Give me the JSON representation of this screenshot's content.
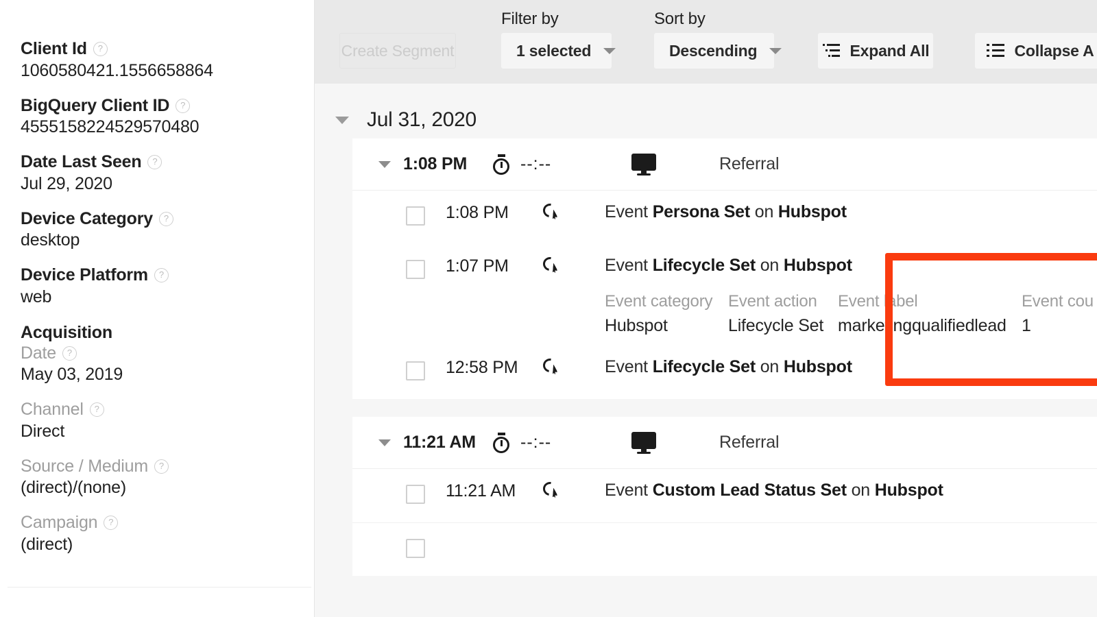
{
  "sidebar": {
    "fields": [
      {
        "label": "Client Id",
        "muted": false,
        "help": "?",
        "value": "1060580421.1556658864"
      },
      {
        "label": "BigQuery Client ID",
        "muted": false,
        "help": "?",
        "value": "4555158224529570480"
      },
      {
        "label": "Date Last Seen",
        "muted": false,
        "help": "?",
        "value": "Jul 29, 2020"
      },
      {
        "label": "Device Category",
        "muted": false,
        "help": "?",
        "value": "desktop"
      },
      {
        "label": "Device Platform",
        "muted": false,
        "help": "?",
        "value": "web"
      }
    ],
    "acquisition_heading": "Acquisition",
    "acquisition_fields": [
      {
        "label": "Date",
        "muted": true,
        "help": "?",
        "value": "May 03, 2019"
      },
      {
        "label": "Channel",
        "muted": true,
        "help": "?",
        "value": "Direct"
      },
      {
        "label": "Source / Medium",
        "muted": true,
        "help": "?",
        "value": "(direct)/(none)"
      },
      {
        "label": "Campaign",
        "muted": true,
        "help": "?",
        "value": "(direct)"
      }
    ]
  },
  "toolbar": {
    "create_segment_label": "Create Segment",
    "filter_caption": "Filter by",
    "filter_value": "1 selected",
    "sort_caption": "Sort by",
    "sort_value": "Descending",
    "expand_all_label": "Expand All",
    "collapse_all_label": "Collapse A"
  },
  "timeline": {
    "day_label": "Jul 31, 2020",
    "sessions": [
      {
        "time": "1:08 PM",
        "duration": "--:--",
        "channel": "Referral",
        "events": [
          {
            "time": "1:08 PM",
            "prefix": "Event ",
            "name": "Persona Set",
            "middle": " on ",
            "source": "Hubspot",
            "expanded": false
          },
          {
            "time": "1:07 PM",
            "prefix": "Event ",
            "name": "Lifecycle Set",
            "middle": " on ",
            "source": "Hubspot",
            "expanded": true,
            "params": [
              {
                "key": "Event category",
                "value": "Hubspot"
              },
              {
                "key": "Event action",
                "value": "Lifecycle Set"
              },
              {
                "key": "Event label",
                "value": "marketingqualifiedlead"
              },
              {
                "key": "Event cou",
                "value": "1"
              }
            ]
          },
          {
            "time": "12:58 PM",
            "prefix": "Event ",
            "name": "Lifecycle Set",
            "middle": " on ",
            "source": "Hubspot",
            "expanded": false
          }
        ]
      },
      {
        "time": "11:21 AM",
        "duration": "--:--",
        "channel": "Referral",
        "events": [
          {
            "time": "11:21 AM",
            "prefix": "Event ",
            "name": "Custom Lead Status Set",
            "middle": " on ",
            "source": "Hubspot",
            "expanded": false
          }
        ]
      }
    ]
  },
  "annotation": {
    "color": "#fa3b0f"
  }
}
